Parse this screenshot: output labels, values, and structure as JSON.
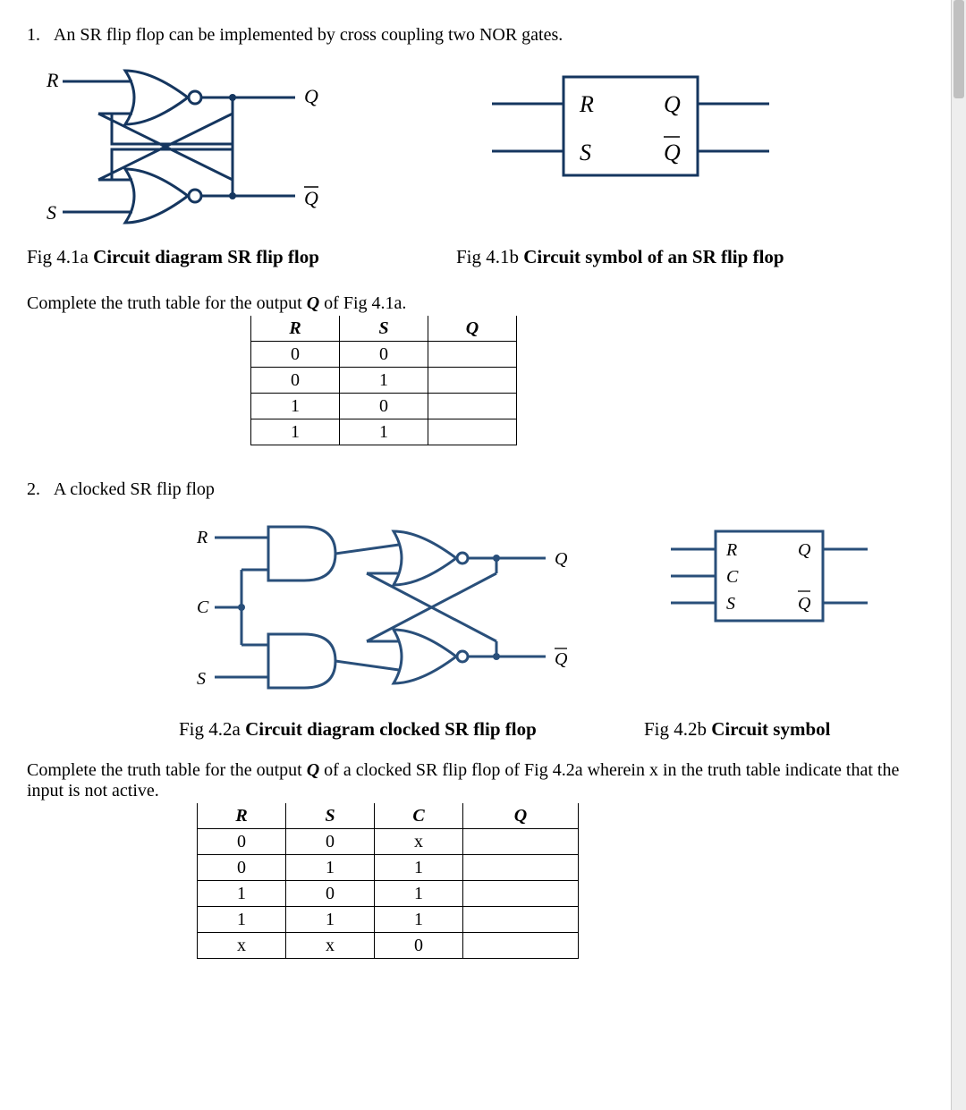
{
  "q1": {
    "number": "1.",
    "text": "An SR flip flop can be implemented by cross coupling two NOR gates.",
    "fig_a_caption_prefix": "Fig 4.1a ",
    "fig_a_caption_bold": "Circuit diagram SR flip flop",
    "fig_b_caption_prefix": "Fig 4.1b ",
    "fig_b_caption_bold": "Circuit symbol of an SR flip flop",
    "labels": {
      "R": "R",
      "S": "S",
      "Q": "Q",
      "Qbar": "Q"
    },
    "instr_pre": "Complete the truth table for the output ",
    "instr_Q": "Q",
    "instr_post": " of Fig 4.1a.",
    "table": {
      "headers": [
        "R",
        "S",
        "Q"
      ],
      "rows": [
        [
          "0",
          "0",
          ""
        ],
        [
          "0",
          "1",
          ""
        ],
        [
          "1",
          "0",
          ""
        ],
        [
          "1",
          "1",
          ""
        ]
      ]
    }
  },
  "q2": {
    "number": "2.",
    "text": "A clocked SR flip flop",
    "labels": {
      "R": "R",
      "C": "C",
      "S": "S",
      "Q": "Q",
      "Qbar": "Q"
    },
    "fig_a_caption_prefix": "Fig 4.2a ",
    "fig_a_caption_bold": "Circuit diagram clocked SR flip flop",
    "fig_b_caption_prefix": "Fig 4.2b ",
    "fig_b_caption_bold": "Circuit symbol",
    "instr_pre": "Complete the truth table for the output ",
    "instr_Q": "Q",
    "instr_mid": " of a clocked SR flip flop of Fig 4.2a wherein x in the truth table indicate that the input is not active.",
    "table": {
      "headers": [
        "R",
        "S",
        "C",
        "Q"
      ],
      "rows": [
        [
          "0",
          "0",
          "x",
          ""
        ],
        [
          "0",
          "1",
          "1",
          ""
        ],
        [
          "1",
          "0",
          "1",
          ""
        ],
        [
          "1",
          "1",
          "1",
          ""
        ],
        [
          "x",
          "x",
          "0",
          ""
        ]
      ]
    }
  }
}
